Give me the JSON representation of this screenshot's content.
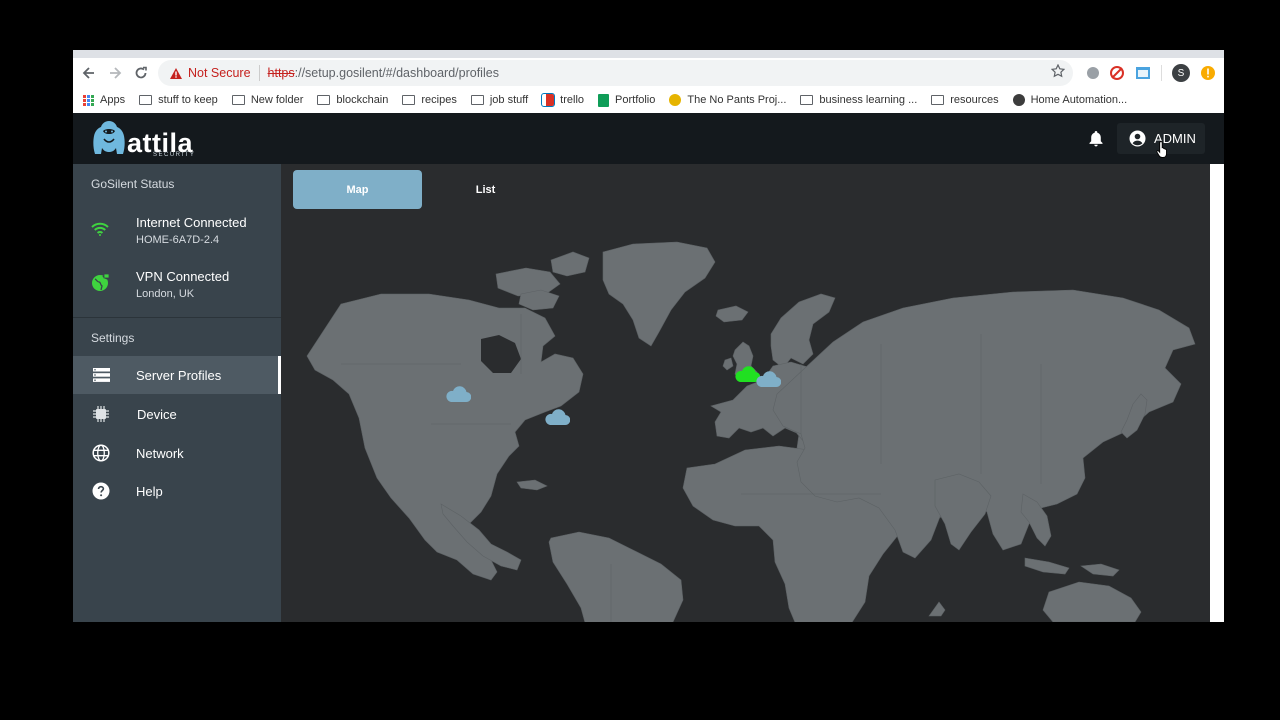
{
  "browser": {
    "security_label": "Not Secure",
    "url_scheme": "https",
    "url_rest": "://setup.gosilent/#/dashboard/profiles",
    "profile_initial": "S",
    "bookmarks": [
      {
        "label": "Apps",
        "icon": "apps-grid-icon"
      },
      {
        "label": "stuff to keep",
        "icon": "folder-icon"
      },
      {
        "label": "New folder",
        "icon": "folder-icon"
      },
      {
        "label": "blockchain",
        "icon": "folder-icon"
      },
      {
        "label": "recipes",
        "icon": "folder-icon"
      },
      {
        "label": "job stuff",
        "icon": "folder-icon"
      },
      {
        "label": "trello",
        "icon": "trello-icon"
      },
      {
        "label": "Portfolio",
        "icon": "sheets-icon"
      },
      {
        "label": "The No Pants Proj...",
        "icon": "site-icon"
      },
      {
        "label": "business learning ...",
        "icon": "folder-icon"
      },
      {
        "label": "resources",
        "icon": "folder-icon"
      },
      {
        "label": "Home Automation...",
        "icon": "site-icon"
      }
    ]
  },
  "app": {
    "logo_text": "attila",
    "logo_subtext": "SECURITY",
    "admin_label": "ADMIN"
  },
  "sidebar": {
    "status_heading": "GoSilent Status",
    "status": [
      {
        "title": "Internet Connected",
        "subtitle": "HOME-6A7D-2.4",
        "icon": "wifi-icon"
      },
      {
        "title": "VPN Connected",
        "subtitle": "London, UK",
        "icon": "vpn-globe-icon"
      }
    ],
    "settings_heading": "Settings",
    "menu": [
      {
        "label": "Server Profiles",
        "icon": "server-list-icon",
        "active": true
      },
      {
        "label": "Device",
        "icon": "chip-icon",
        "active": false
      },
      {
        "label": "Network",
        "icon": "globe-icon",
        "active": false
      },
      {
        "label": "Help",
        "icon": "help-icon",
        "active": false
      }
    ]
  },
  "main": {
    "tabs": [
      {
        "label": "Map",
        "active": true
      },
      {
        "label": "List",
        "active": false
      }
    ],
    "servers": [
      {
        "location": "US West",
        "status": "available"
      },
      {
        "location": "US East",
        "status": "available"
      },
      {
        "location": "London, UK",
        "status": "connected"
      },
      {
        "location": "Western Europe",
        "status": "available"
      }
    ]
  },
  "colors": {
    "accent": "#7fafc8",
    "connected": "#21e021",
    "status_green": "#3fd43f",
    "sidebar_bg": "#39444c",
    "topbar_bg": "#14191d",
    "map_land": "#6b7073"
  }
}
